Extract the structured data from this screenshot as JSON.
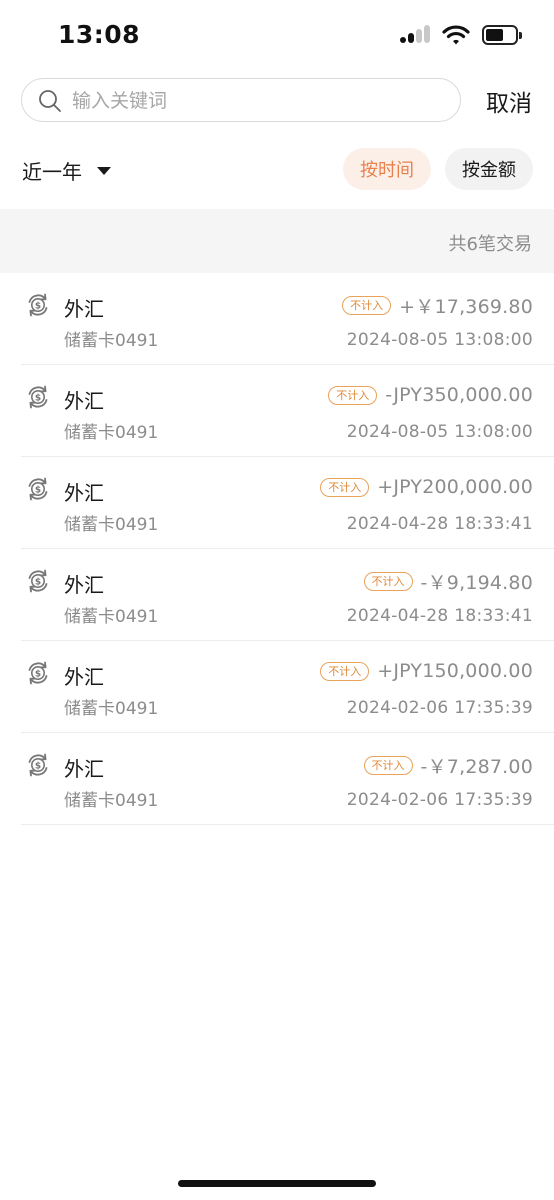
{
  "status_bar": {
    "time": "13:08"
  },
  "search": {
    "placeholder": "输入关键词",
    "value": "",
    "cancel_label": "取消"
  },
  "filters": {
    "period_label": "近一年",
    "sort_time_label": "按时间",
    "sort_amount_label": "按金额",
    "active_sort": "time"
  },
  "summary": {
    "text": "共6笔交易"
  },
  "colors": {
    "accent": "#e9814c",
    "accent_bg": "#fcefe8",
    "tag": "#e08a3a",
    "muted": "#8c8c8c"
  },
  "transactions": [
    {
      "icon": "currency-exchange-icon",
      "title": "外汇",
      "account": "储蓄卡0491",
      "tag": "不计入",
      "amount": "+￥17,369.80",
      "time": "2024-08-05 13:08:00"
    },
    {
      "icon": "currency-exchange-icon",
      "title": "外汇",
      "account": "储蓄卡0491",
      "tag": "不计入",
      "amount": "-JPY350,000.00",
      "time": "2024-08-05 13:08:00"
    },
    {
      "icon": "currency-exchange-icon",
      "title": "外汇",
      "account": "储蓄卡0491",
      "tag": "不计入",
      "amount": "+JPY200,000.00",
      "time": "2024-04-28 18:33:41"
    },
    {
      "icon": "currency-exchange-icon",
      "title": "外汇",
      "account": "储蓄卡0491",
      "tag": "不计入",
      "amount": "-￥9,194.80",
      "time": "2024-04-28 18:33:41"
    },
    {
      "icon": "currency-exchange-icon",
      "title": "外汇",
      "account": "储蓄卡0491",
      "tag": "不计入",
      "amount": "+JPY150,000.00",
      "time": "2024-02-06 17:35:39"
    },
    {
      "icon": "currency-exchange-icon",
      "title": "外汇",
      "account": "储蓄卡0491",
      "tag": "不计入",
      "amount": "-￥7,287.00",
      "time": "2024-02-06 17:35:39"
    }
  ]
}
